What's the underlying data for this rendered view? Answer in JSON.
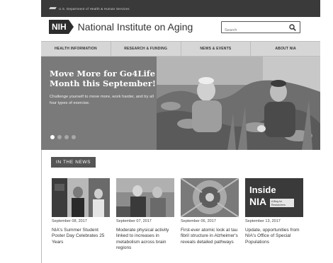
{
  "topbar": {
    "hhs_text": "U.S. Department of Health & Human Services",
    "hhs_icon": "hhs-eagle-icon"
  },
  "header": {
    "logo_text": "NIH",
    "site_title": "National Institute on Aging",
    "search_placeholder": "Search",
    "search_icon": "search-icon"
  },
  "nav": {
    "items": [
      {
        "label": "HEALTH INFORMATION"
      },
      {
        "label": "RESEARCH & FUNDING"
      },
      {
        "label": "NEWS & EVENTS"
      },
      {
        "label": "ABOUT NIA"
      }
    ]
  },
  "hero": {
    "title": "Move More for Go4Life Month this September!",
    "subtitle": "Challenge yourself to move more, work harder, and try all four types of exercise.",
    "slide_count": 4,
    "active_slide": 1
  },
  "news": {
    "heading": "IN THE NEWS",
    "items": [
      {
        "date": "September 08, 2017",
        "title": "NIA's Summer Student Poster Day Celebrates 25 Years"
      },
      {
        "date": "September 07, 2017",
        "title": "Moderate physical activity linked to increases in metabolism across brain regions"
      },
      {
        "date": "September 06, 2017",
        "title": "First-ever atomic look at tau fibril structure in Alzheimer's reveals detailed pathways"
      },
      {
        "date": "September 13, 2017",
        "title": "Update, opportunities from NIA's Office of Special Populations",
        "image_text_big": "Inside NIA",
        "image_text_small": "A Blog for Researchers"
      }
    ]
  },
  "colors": {
    "topbar": "#3a3a3a",
    "nav_bg": "#d6d6d6",
    "hero_bg": "#7a7a7a",
    "news_tag_bg": "#555555"
  }
}
